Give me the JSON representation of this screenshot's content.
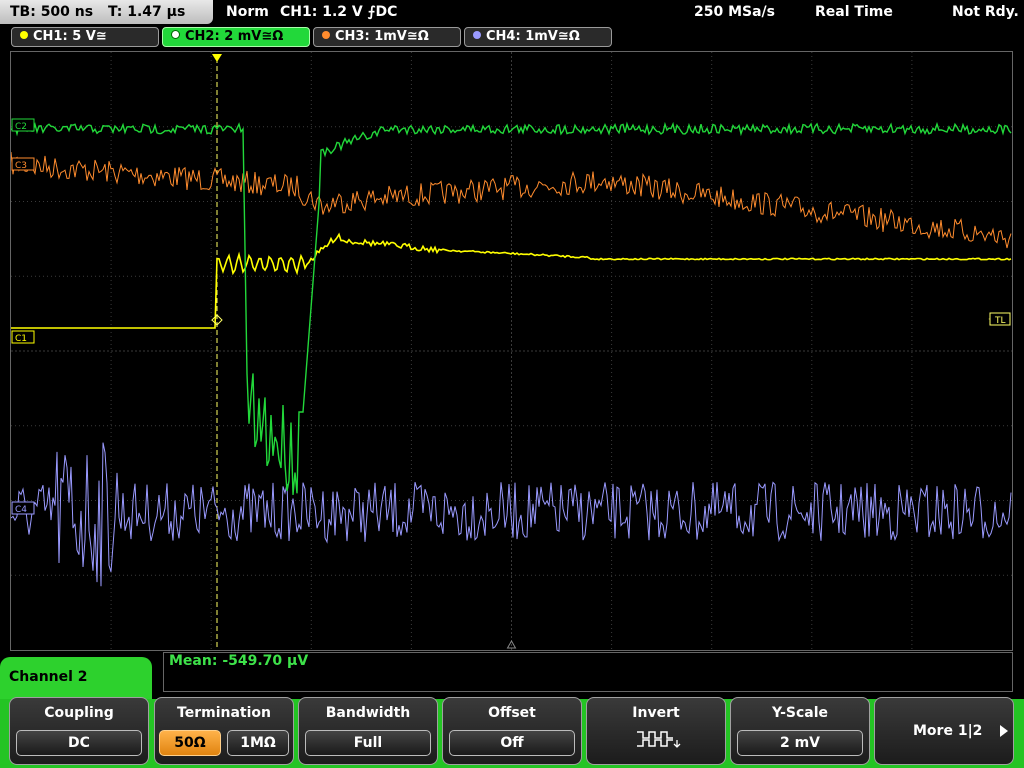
{
  "status": {
    "timebase": "TB: 500 ns",
    "trigger_time": "T: 1.47 µs",
    "mode": "Norm",
    "trigger": "CH1: 1.2 V ⨍DC",
    "sample_rate": "250 MSa/s",
    "acq_mode": "Real Time",
    "state": "Not Rdy."
  },
  "channels": [
    {
      "label": "CH1: 5 V≅",
      "color": "#ffff00",
      "active": false
    },
    {
      "label": "CH2: 2 mV≅Ω",
      "color": "#22d83a",
      "active": true
    },
    {
      "label": "CH3: 1mV≅Ω",
      "color": "#ff8c2e",
      "active": false
    },
    {
      "label": "CH4: 1mV≅Ω",
      "color": "#9a9aff",
      "active": false
    }
  ],
  "markers": {
    "ch1": "C1",
    "ch2": "C2",
    "ch3": "C3",
    "ch4": "C4",
    "trigger_level": "TL"
  },
  "measurement": {
    "mean": "Mean: -549.70 µV"
  },
  "menu": {
    "title": "Channel 2",
    "coupling": {
      "title": "Coupling",
      "value": "DC"
    },
    "termination": {
      "title": "Termination",
      "options": [
        "50Ω",
        "1MΩ"
      ],
      "selected": "50Ω"
    },
    "bandwidth": {
      "title": "Bandwidth",
      "value": "Full"
    },
    "offset": {
      "title": "Offset",
      "value": "Off"
    },
    "invert": {
      "title": "Invert",
      "icon": "invert-waveform-icon"
    },
    "yscale": {
      "title": "Y-Scale",
      "value": "2 mV"
    },
    "more": {
      "label": "More 1|2",
      "icon": "arrow-right-icon"
    }
  },
  "colors": {
    "ch1": "#ffff00",
    "ch2": "#22d83a",
    "ch3": "#ff8c2e",
    "ch4": "#9a9aff",
    "grid": "#3a3a3a"
  }
}
